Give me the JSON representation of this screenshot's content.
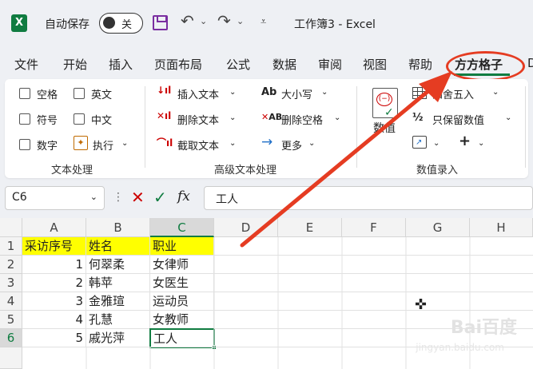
{
  "titlebar": {
    "app_logo": "X",
    "autosave_label": "自动保存",
    "toggle_text": "关",
    "doc_title": "工作簿3  -  Excel"
  },
  "tabs": [
    "文件",
    "开始",
    "插入",
    "页面布局",
    "公式",
    "数据",
    "审阅",
    "视图",
    "帮助",
    "方方格子",
    "D"
  ],
  "ribbon": {
    "text_group": {
      "items": [
        "空格",
        "英文",
        "符号",
        "中文",
        "数字",
        "执行"
      ],
      "label": "文本处理"
    },
    "advanced_group": {
      "insert_text": "插入文本",
      "delete_text": "删除文本",
      "extract_text": "截取文本",
      "case": "大小写",
      "delete_space": "删除空格",
      "more": "更多",
      "label": "高级文本处理"
    },
    "numeric_group": {
      "numeric_big": "数值",
      "round": "四舍五入",
      "keep_numeric": "只保留数值",
      "label": "数值录入"
    }
  },
  "formula_bar": {
    "name_box": "C6",
    "fx": "fx",
    "value": "工人"
  },
  "grid": {
    "columns": [
      "A",
      "B",
      "C",
      "D",
      "E",
      "F",
      "G",
      "H"
    ],
    "rows": [
      "1",
      "2",
      "3",
      "4",
      "5",
      "6"
    ],
    "data": [
      [
        "采访序号",
        "姓名",
        "职业"
      ],
      [
        "1",
        "何翠柔",
        "女律师"
      ],
      [
        "2",
        "韩苹",
        "女医生"
      ],
      [
        "3",
        "金雅瑄",
        "运动员"
      ],
      [
        "4",
        "孔慧",
        "女教师"
      ],
      [
        "5",
        "戚光萍",
        "工人"
      ]
    ]
  },
  "watermark": {
    "brand": "Bai百度",
    "sub": "jingyan.baidu.com"
  },
  "colors": {
    "excel_green": "#107c41",
    "header_fill": "#ffff00",
    "annotation_red": "#e53c22"
  }
}
